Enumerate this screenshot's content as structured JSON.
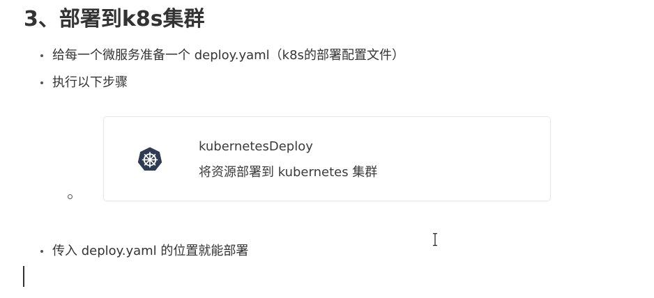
{
  "heading": "3、部署到k8s集群",
  "bullets": [
    "给每一个微服务准备一个 deploy.yaml（k8s的部署配置文件）",
    "执行以下步骤",
    "传入 deploy.yaml 的位置就能部署"
  ],
  "card": {
    "icon": "kubernetes-helm-icon",
    "title": "kubernetesDeploy",
    "description": "将资源部署到 kubernetes 集群"
  },
  "colors": {
    "text": "#333333",
    "card_border": "#e5e7eb",
    "icon": "#2f3b52"
  }
}
